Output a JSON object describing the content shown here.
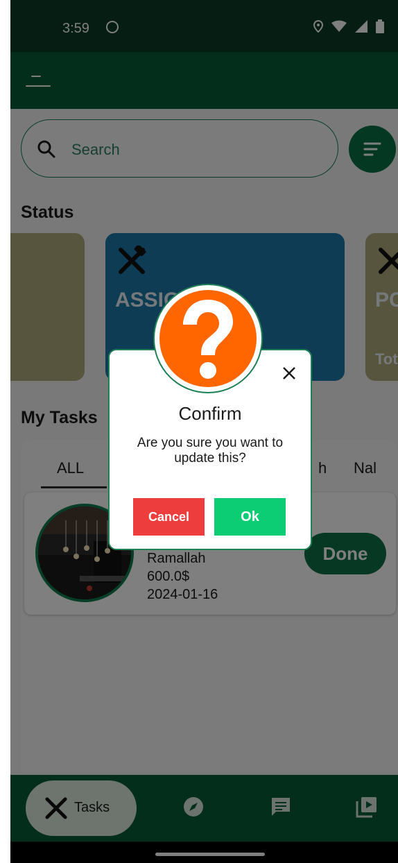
{
  "status_bar": {
    "time": "3:59"
  },
  "search": {
    "placeholder": "Search"
  },
  "status_section": {
    "title": "Status",
    "cards": [
      {
        "label": "",
        "subtitle": ""
      },
      {
        "label": "ASSIG",
        "subtitle": ""
      },
      {
        "label": "PC",
        "subtitle": "Tot"
      }
    ]
  },
  "tasks_section": {
    "title": "My Tasks",
    "tabs": [
      "ALL",
      "h",
      "Nal"
    ]
  },
  "task": {
    "city": "Ramallah",
    "price": "600.0$",
    "date": "2024-01-16",
    "action_label": "Done"
  },
  "bottom_nav": {
    "tasks_label": "Tasks"
  },
  "dialog": {
    "title": "Confirm",
    "message": "Are you sure you want to update this?",
    "cancel_label": "Cancel",
    "ok_label": "Ok"
  },
  "colors": {
    "app_bar": "#065c37",
    "status_bar": "#0a3b27",
    "accent": "#0d7046",
    "cancel": "#ee3d3d",
    "ok": "#0ccd73",
    "question_badge": "#ff6600",
    "card_blue": "#1a79a8",
    "card_khaki": "#b1aa7d"
  }
}
